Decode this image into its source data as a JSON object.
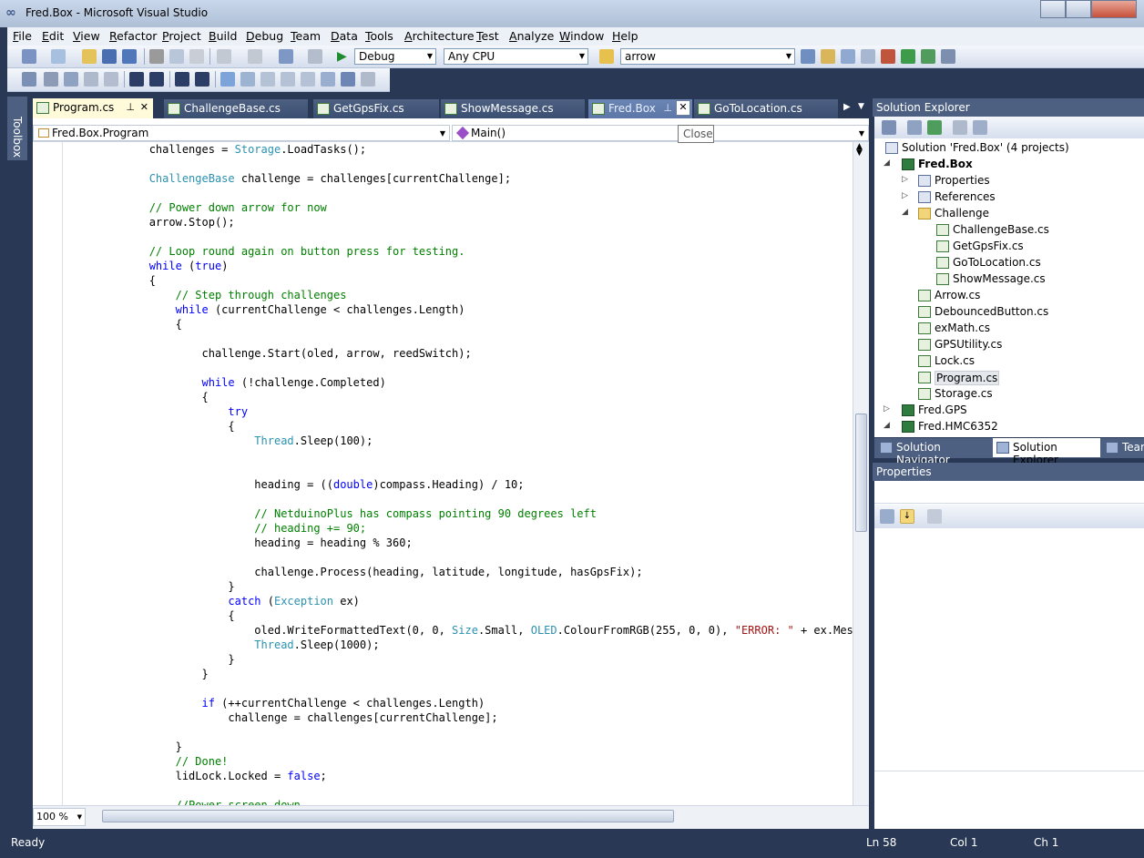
{
  "window": {
    "title": "Fred.Box - Microsoft Visual Studio"
  },
  "menu": [
    "File",
    "Edit",
    "View",
    "Refactor",
    "Project",
    "Build",
    "Debug",
    "Team",
    "Data",
    "Tools",
    "Architecture",
    "Test",
    "Analyze",
    "Window",
    "Help"
  ],
  "toolbar": {
    "config": "Debug",
    "platform": "Any CPU",
    "find": "arrow"
  },
  "tabs": [
    {
      "label": "Program.cs",
      "state": "active"
    },
    {
      "label": "ChallengeBase.cs",
      "state": "normal"
    },
    {
      "label": "GetGpsFix.cs",
      "state": "normal"
    },
    {
      "label": "ShowMessage.cs",
      "state": "normal"
    },
    {
      "label": "Fred.Box",
      "state": "preview"
    },
    {
      "label": "GoToLocation.cs",
      "state": "normal"
    }
  ],
  "tooltip": "Close",
  "navbar": {
    "type": "Fred.Box.Program",
    "member": "Main()"
  },
  "toolbox_label": "Toolbox",
  "code_lines": [
    [
      {
        "t": "            challenges = "
      },
      {
        "t": "Storage",
        "c": "ty"
      },
      {
        "t": ".LoadTasks();"
      }
    ],
    [],
    [
      {
        "t": "            "
      },
      {
        "t": "ChallengeBase",
        "c": "ty"
      },
      {
        "t": " challenge = challenges[currentChallenge];"
      }
    ],
    [],
    [
      {
        "t": "            "
      },
      {
        "t": "// Power down arrow for now",
        "c": "cm"
      }
    ],
    [
      {
        "t": "            arrow.Stop();"
      }
    ],
    [],
    [
      {
        "t": "            "
      },
      {
        "t": "// Loop round again on button press for testing.",
        "c": "cm"
      }
    ],
    [
      {
        "t": "            "
      },
      {
        "t": "while",
        "c": "kw"
      },
      {
        "t": " ("
      },
      {
        "t": "true",
        "c": "kw"
      },
      {
        "t": ")"
      }
    ],
    [
      {
        "t": "            {"
      }
    ],
    [
      {
        "t": "                "
      },
      {
        "t": "// Step through challenges",
        "c": "cm"
      }
    ],
    [
      {
        "t": "                "
      },
      {
        "t": "while",
        "c": "kw"
      },
      {
        "t": " (currentChallenge < challenges.Length)"
      }
    ],
    [
      {
        "t": "                {"
      }
    ],
    [],
    [
      {
        "t": "                    challenge.Start(oled, arrow, reedSwitch);"
      }
    ],
    [],
    [
      {
        "t": "                    "
      },
      {
        "t": "while",
        "c": "kw"
      },
      {
        "t": " (!challenge.Completed)"
      }
    ],
    [
      {
        "t": "                    {"
      }
    ],
    [
      {
        "t": "                        "
      },
      {
        "t": "try",
        "c": "kw"
      }
    ],
    [
      {
        "t": "                        {"
      }
    ],
    [
      {
        "t": "                            "
      },
      {
        "t": "Thread",
        "c": "ty"
      },
      {
        "t": ".Sleep(100);"
      }
    ],
    [],
    [],
    [
      {
        "t": "                            heading = (("
      },
      {
        "t": "double",
        "c": "kw"
      },
      {
        "t": ")compass.Heading) / 10;"
      }
    ],
    [],
    [
      {
        "t": "                            "
      },
      {
        "t": "// NetduinoPlus has compass pointing 90 degrees left",
        "c": "cm"
      }
    ],
    [
      {
        "t": "                            "
      },
      {
        "t": "// heading += 90;",
        "c": "cm"
      }
    ],
    [
      {
        "t": "                            heading = heading % 360;"
      }
    ],
    [],
    [
      {
        "t": "                            challenge.Process(heading, latitude, longitude, hasGpsFix);"
      }
    ],
    [
      {
        "t": "                        }"
      }
    ],
    [
      {
        "t": "                        "
      },
      {
        "t": "catch",
        "c": "kw"
      },
      {
        "t": " ("
      },
      {
        "t": "Exception",
        "c": "ty"
      },
      {
        "t": " ex)"
      }
    ],
    [
      {
        "t": "                        {"
      }
    ],
    [
      {
        "t": "                            oled.WriteFormattedText(0, 0, "
      },
      {
        "t": "Size",
        "c": "ty"
      },
      {
        "t": ".Small, "
      },
      {
        "t": "OLED",
        "c": "ty"
      },
      {
        "t": ".ColourFromRGB(255, 0, 0), "
      },
      {
        "t": "\"ERROR: \"",
        "c": "st"
      },
      {
        "t": " + ex.Message);"
      }
    ],
    [
      {
        "t": "                            "
      },
      {
        "t": "Thread",
        "c": "ty"
      },
      {
        "t": ".Sleep(1000);"
      }
    ],
    [
      {
        "t": "                        }"
      }
    ],
    [
      {
        "t": "                    }"
      }
    ],
    [],
    [
      {
        "t": "                    "
      },
      {
        "t": "if",
        "c": "kw"
      },
      {
        "t": " (++currentChallenge < challenges.Length)"
      }
    ],
    [
      {
        "t": "                        challenge = challenges[currentChallenge];"
      }
    ],
    [],
    [
      {
        "t": "                }"
      }
    ],
    [
      {
        "t": "                "
      },
      {
        "t": "// Done!",
        "c": "cm"
      }
    ],
    [
      {
        "t": "                lidLock.Locked = "
      },
      {
        "t": "false",
        "c": "kw"
      },
      {
        "t": ";"
      }
    ],
    [],
    [
      {
        "t": "                "
      },
      {
        "t": "//Power screen down",
        "c": "cm"
      }
    ]
  ],
  "zoom": "100 %",
  "solution_explorer": {
    "title": "Solution Explorer",
    "items": [
      {
        "label": "Solution 'Fred.Box' (4 projects)",
        "level": 0,
        "icon": "sol",
        "tri": ""
      },
      {
        "label": "Fred.Box",
        "level": 1,
        "icon": "proj",
        "tri": "open",
        "bold": true
      },
      {
        "label": "Properties",
        "level": 2,
        "icon": "sol",
        "tri": "closed"
      },
      {
        "label": "References",
        "level": 2,
        "icon": "sol",
        "tri": "closed"
      },
      {
        "label": "Challenge",
        "level": 2,
        "icon": "folder",
        "tri": "open"
      },
      {
        "label": "ChallengeBase.cs",
        "level": 3,
        "icon": "cs",
        "tri": ""
      },
      {
        "label": "GetGpsFix.cs",
        "level": 3,
        "icon": "cs",
        "tri": ""
      },
      {
        "label": "GoToLocation.cs",
        "level": 3,
        "icon": "cs",
        "tri": ""
      },
      {
        "label": "ShowMessage.cs",
        "level": 3,
        "icon": "cs",
        "tri": ""
      },
      {
        "label": "Arrow.cs",
        "level": 2,
        "icon": "cs",
        "tri": ""
      },
      {
        "label": "DebouncedButton.cs",
        "level": 2,
        "icon": "cs",
        "tri": ""
      },
      {
        "label": "exMath.cs",
        "level": 2,
        "icon": "cs",
        "tri": ""
      },
      {
        "label": "GPSUtility.cs",
        "level": 2,
        "icon": "cs",
        "tri": ""
      },
      {
        "label": "Lock.cs",
        "level": 2,
        "icon": "cs",
        "tri": ""
      },
      {
        "label": "Program.cs",
        "level": 2,
        "icon": "cs",
        "tri": "",
        "selected": true
      },
      {
        "label": "Storage.cs",
        "level": 2,
        "icon": "cs",
        "tri": ""
      },
      {
        "label": "Fred.GPS",
        "level": 1,
        "icon": "proj",
        "tri": "closed"
      },
      {
        "label": "Fred.HMC6352",
        "level": 1,
        "icon": "proj",
        "tri": "open"
      }
    ],
    "bottom_tabs": [
      "Solution Navigator",
      "Solution Explorer",
      "Team"
    ]
  },
  "properties": {
    "title": "Properties"
  },
  "status": {
    "text": "Ready",
    "ln": "Ln 58",
    "col": "Col 1",
    "ch": "Ch 1"
  }
}
